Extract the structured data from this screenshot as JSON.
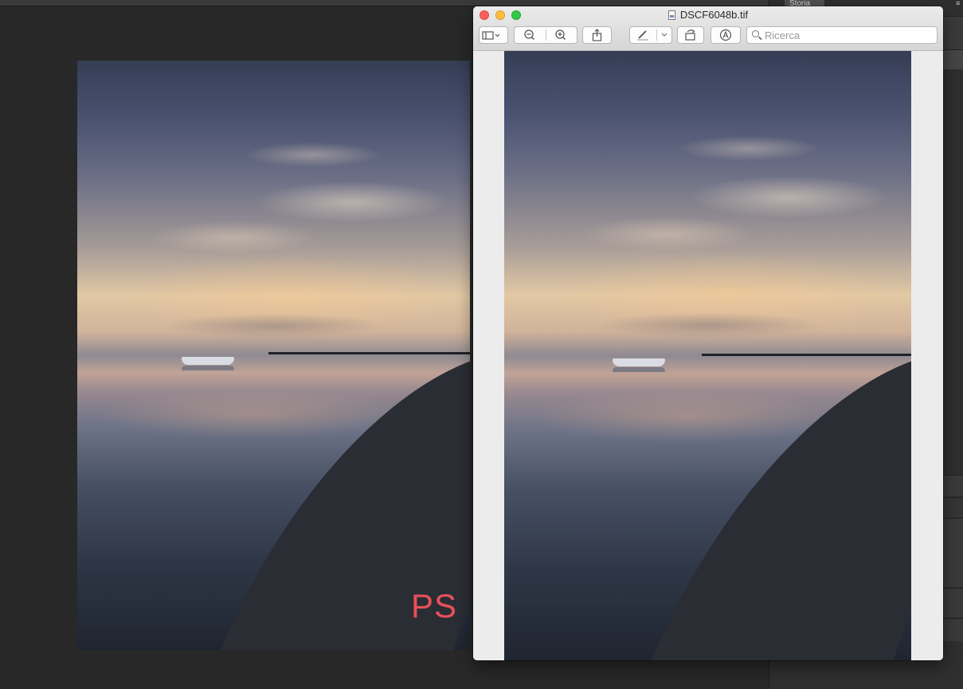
{
  "photoshop": {
    "panel_tab": "Storia",
    "overlay_label": "PS"
  },
  "preview": {
    "window_title": "DSCF6048b.tif",
    "search": {
      "placeholder": "Ricerca",
      "value": ""
    },
    "toolbar": {
      "sidebar_button": "sidebar-icon",
      "zoom_out_button": "zoom-out-icon",
      "zoom_in_button": "zoom-in-icon",
      "share_button": "share-icon",
      "markup_pen_button": "pen-icon",
      "markup_dropdown": "chevron-down-icon",
      "rotate_button": "rotate-icon",
      "annotate_button": "markup-icon"
    }
  },
  "colors": {
    "ps_label": "#e8505b",
    "close": "#fc605c",
    "minimize": "#fdbc40",
    "maximize": "#34c84a"
  }
}
